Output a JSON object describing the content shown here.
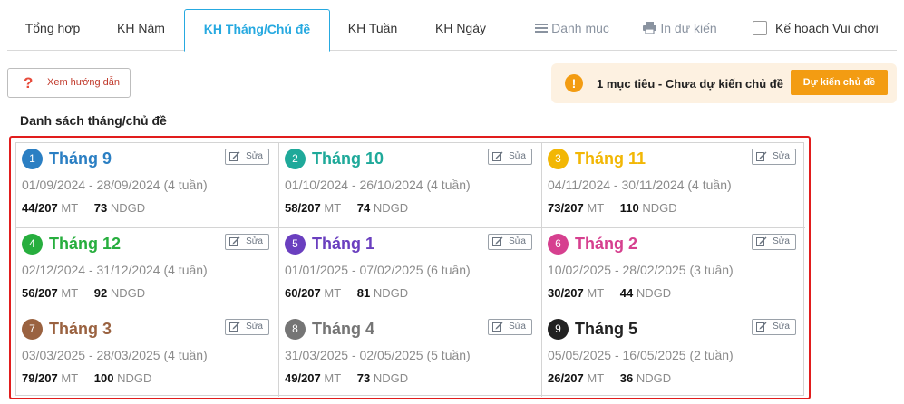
{
  "tabs": [
    {
      "label": "Tổng hợp"
    },
    {
      "label": "KH Năm"
    },
    {
      "label": "KH Tháng/Chủ đề"
    },
    {
      "label": "KH Tuần"
    },
    {
      "label": "KH Ngày"
    }
  ],
  "toolbar": {
    "catalog_label": "Danh mục",
    "print_label": "In dự kiến",
    "play_plan_label": "Kế hoạch Vui chơi"
  },
  "help_button_label": "Xem hướng dẫn",
  "banner": {
    "message": "1 mục tiêu - Chưa dự kiến chủ đề",
    "button_label": "Dự kiến chủ đề",
    "color": "#f39c12"
  },
  "section_title": "Danh sách tháng/chủ đề",
  "edit_label": "Sửa",
  "mt_unit": "MT",
  "ndgd_unit": "NDGD",
  "months": [
    {
      "num": "1",
      "name": "Tháng 9",
      "dates": "01/09/2024 - 28/09/2024 (4 tuần)",
      "mt": "44/207",
      "ndgd": "73",
      "color": "#2b7fc3"
    },
    {
      "num": "2",
      "name": "Tháng 10",
      "dates": "01/10/2024 - 26/10/2024 (4 tuần)",
      "mt": "58/207",
      "ndgd": "74",
      "color": "#1fa99a"
    },
    {
      "num": "3",
      "name": "Tháng 11",
      "dates": "04/11/2024 - 30/11/2024 (4 tuần)",
      "mt": "73/207",
      "ndgd": "110",
      "color": "#f2b705"
    },
    {
      "num": "4",
      "name": "Tháng 12",
      "dates": "02/12/2024 - 31/12/2024 (4 tuần)",
      "mt": "56/207",
      "ndgd": "92",
      "color": "#27ae3e"
    },
    {
      "num": "5",
      "name": "Tháng 1",
      "dates": "01/01/2025 - 07/02/2025 (6 tuần)",
      "mt": "60/207",
      "ndgd": "81",
      "color": "#6a3fbf"
    },
    {
      "num": "6",
      "name": "Tháng 2",
      "dates": "10/02/2025 - 28/02/2025 (3 tuần)",
      "mt": "30/207",
      "ndgd": "44",
      "color": "#d6408f"
    },
    {
      "num": "7",
      "name": "Tháng 3",
      "dates": "03/03/2025 - 28/03/2025 (4 tuần)",
      "mt": "79/207",
      "ndgd": "100",
      "color": "#9a6240"
    },
    {
      "num": "8",
      "name": "Tháng 4",
      "dates": "31/03/2025 - 02/05/2025 (5 tuần)",
      "mt": "49/207",
      "ndgd": "73",
      "color": "#757575"
    },
    {
      "num": "9",
      "name": "Tháng 5",
      "dates": "05/05/2025 - 16/05/2025 (2 tuần)",
      "mt": "26/207",
      "ndgd": "36",
      "color": "#222222"
    }
  ]
}
